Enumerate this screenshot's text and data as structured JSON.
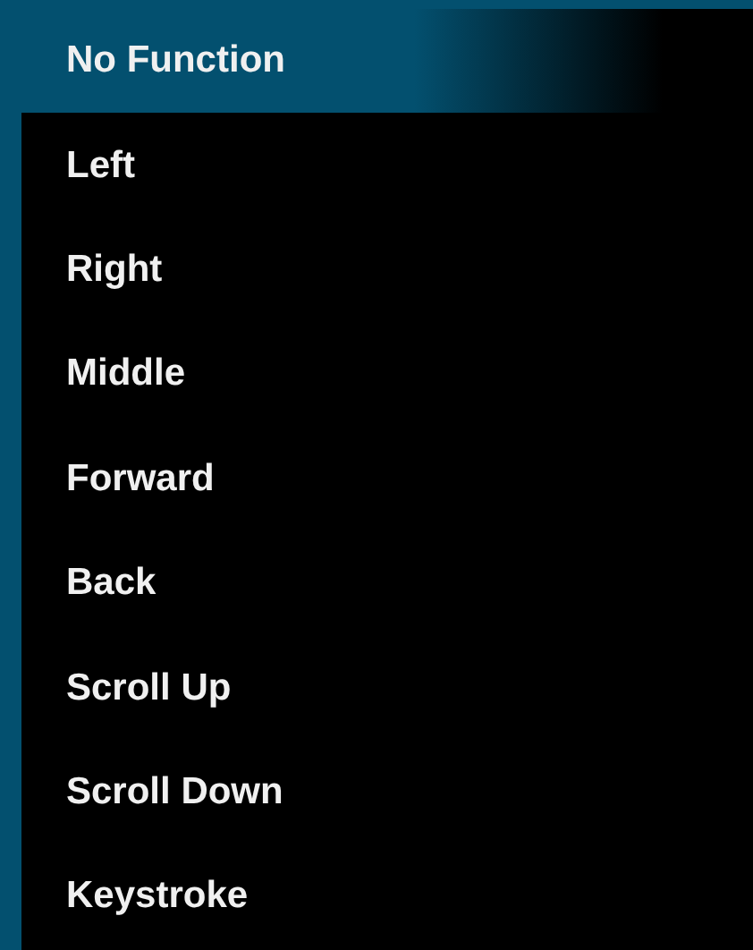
{
  "menu": {
    "items": [
      {
        "label": "No Function",
        "selected": true
      },
      {
        "label": "Left",
        "selected": false
      },
      {
        "label": "Right",
        "selected": false
      },
      {
        "label": "Middle",
        "selected": false
      },
      {
        "label": "Forward",
        "selected": false
      },
      {
        "label": "Back",
        "selected": false
      },
      {
        "label": "Scroll Up",
        "selected": false
      },
      {
        "label": "Scroll Down",
        "selected": false
      },
      {
        "label": "Keystroke",
        "selected": false
      }
    ]
  }
}
